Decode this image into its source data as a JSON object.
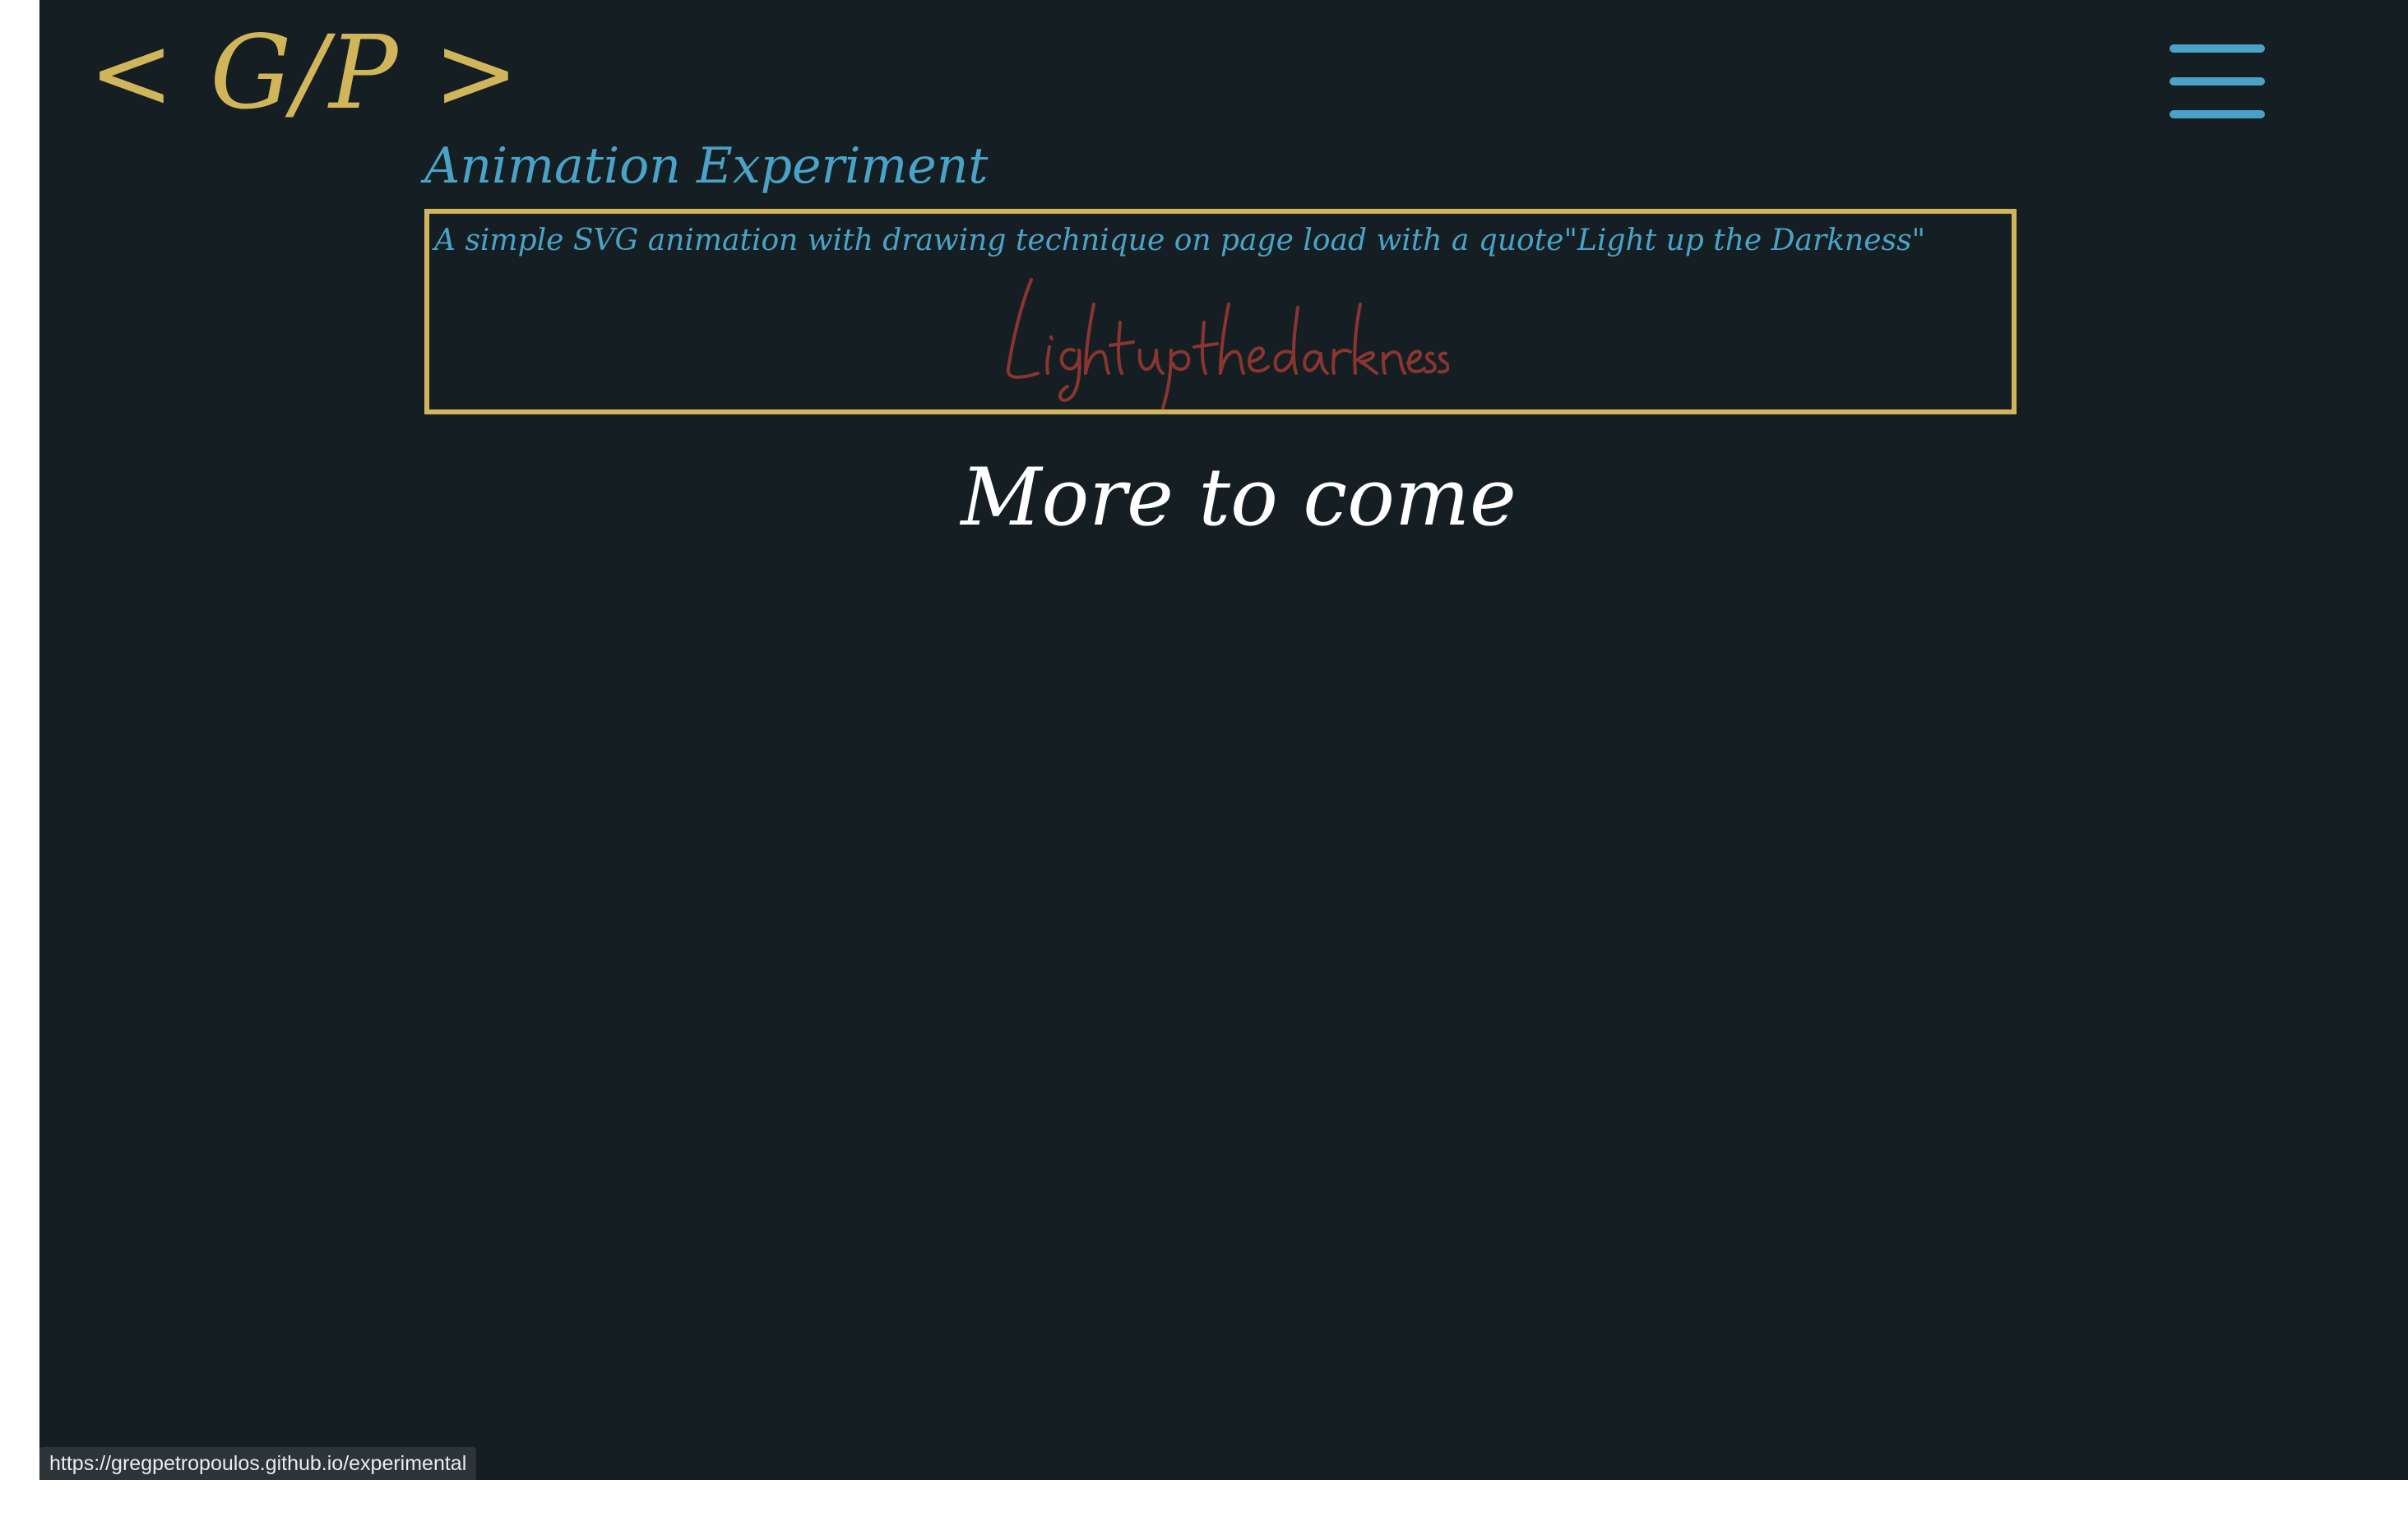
{
  "header": {
    "logo": {
      "open_bracket": "<",
      "initials": "G/P",
      "close_bracket": ">"
    },
    "menu_icon": "hamburger-menu-icon"
  },
  "main": {
    "title": "Animation Experiment",
    "card": {
      "description": "A simple SVG animation with drawing technique on page load with a quote\"Light up the Darkness\"",
      "handwritten_quote": "Lightupthedarkness"
    },
    "more_heading": "More to come"
  },
  "status_bar": {
    "url": "https://gregpetropoulos.github.io/experimental"
  },
  "colors": {
    "background": "#151f23",
    "accent_gold": "#d0b55b",
    "accent_blue": "#4aa3c7",
    "signature_red": "#8a3530",
    "text_white": "#ffffff"
  }
}
